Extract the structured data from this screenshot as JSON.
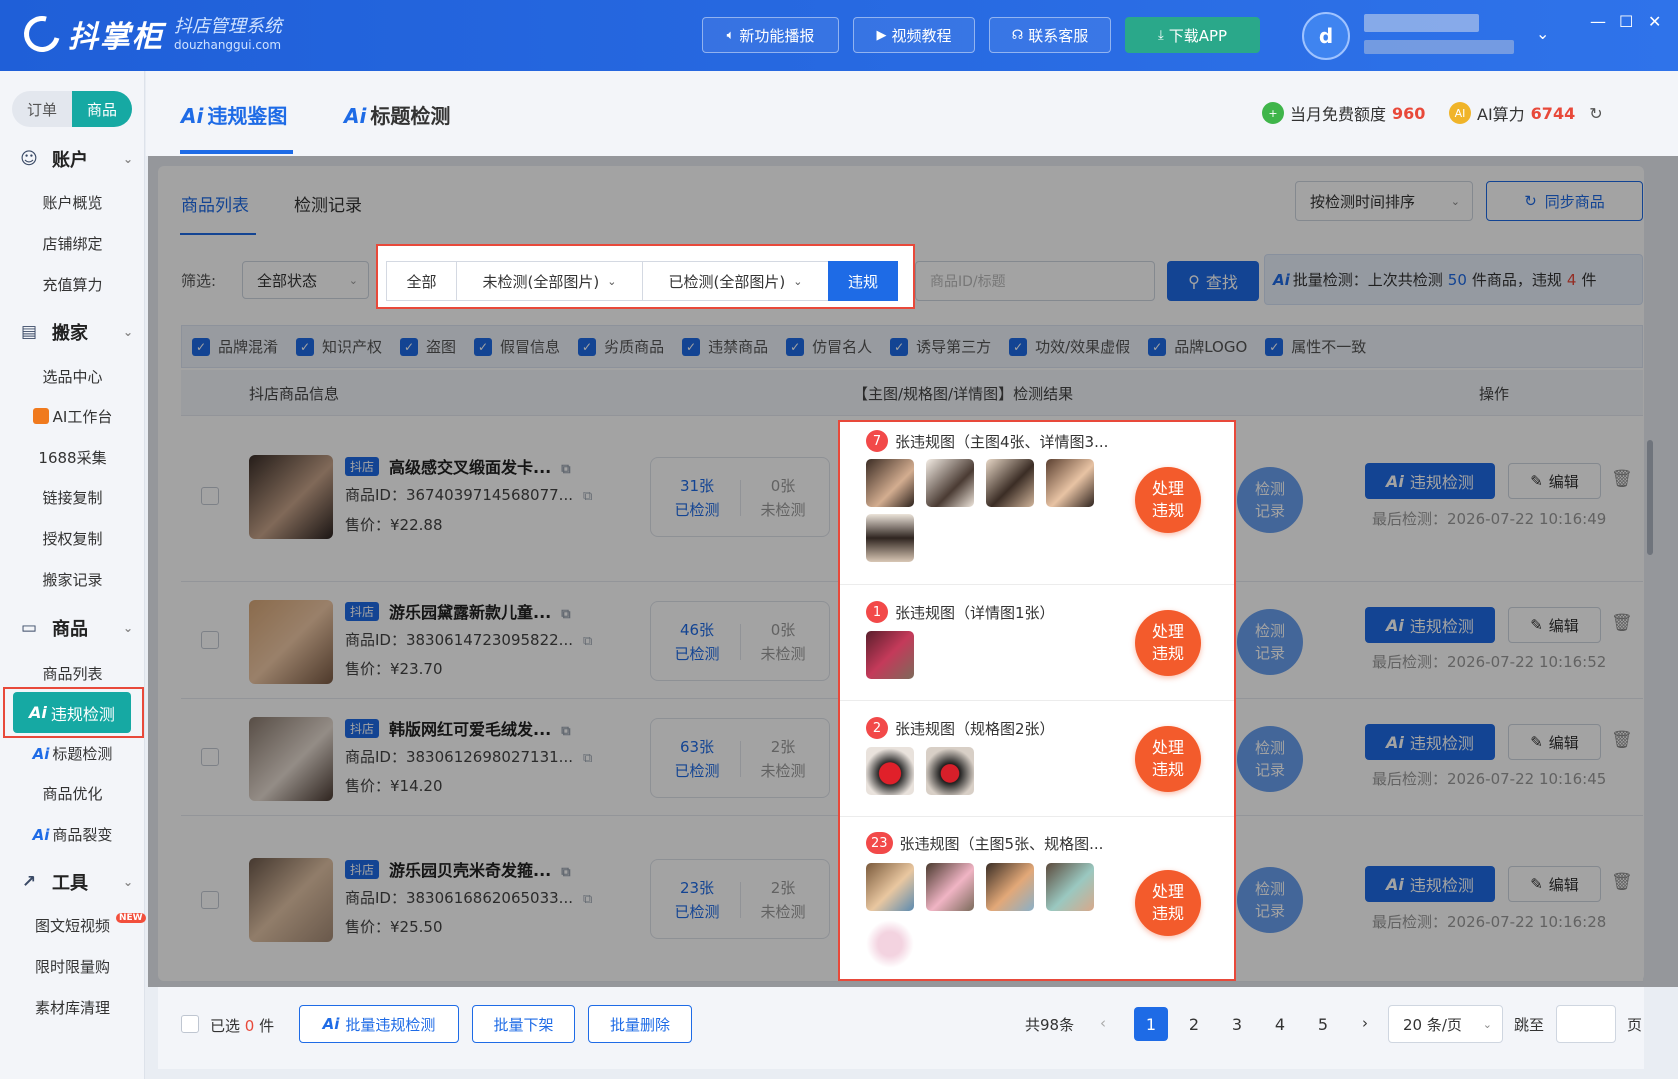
{
  "app": {
    "logo_name": "抖掌柜",
    "logo_subtitle": "抖店管理系统",
    "logo_domain": "douzhanggui.com",
    "avatar_glyph": "d",
    "top_buttons": [
      {
        "icon": "speaker-icon",
        "label": "新功能播报"
      },
      {
        "icon": "video-icon",
        "label": "视频教程"
      },
      {
        "icon": "headset-icon",
        "label": "联系客服"
      },
      {
        "icon": "download-icon",
        "label": "下载APP"
      }
    ]
  },
  "sidebar": {
    "seg_order": "订单",
    "seg_goods": "商品",
    "sections": [
      {
        "title": "账户",
        "icon": "account-icon",
        "items": [
          "账户概览",
          "店铺绑定",
          "充值算力"
        ]
      },
      {
        "title": "搬家",
        "icon": "move-icon",
        "items": [
          "选品中心",
          "AI工作台",
          "1688采集",
          "链接复制",
          "授权复制",
          "搬家记录"
        ]
      },
      {
        "title": "商品",
        "icon": "goods-icon",
        "items": [
          "商品列表",
          "违规检测",
          "标题检测",
          "商品优化",
          "商品裂变"
        ]
      },
      {
        "title": "工具",
        "icon": "chart-icon",
        "items": [
          "图文短视频",
          "限时限量购",
          "素材库清理"
        ]
      }
    ],
    "ai_prefix": "Ai",
    "new_badge": "NEW"
  },
  "header": {
    "tabs": [
      "违规鉴图",
      "标题检测"
    ],
    "ai_prefix": "Ai",
    "quota_label": "当月免费额度",
    "quota_value": "960",
    "power_label": "AI算力",
    "power_value": "6744"
  },
  "panel": {
    "tabs": [
      "商品列表",
      "检测记录"
    ],
    "sort_label": "按检测时间排序",
    "sync_label": "同步商品",
    "filter_label": "筛选:",
    "status_select": "全部状态",
    "seg": [
      "全部",
      "未检测(全部图片)",
      "已检测(全部图片)",
      "违规"
    ],
    "search_placeholder": "商品ID/标题",
    "find_label": "查找",
    "batch_prefix": "批量检测：上次共检测",
    "batch_count": "50",
    "batch_mid": "件商品，违规",
    "batch_violations": "4",
    "batch_suffix": "件",
    "categories": [
      "品牌混淆",
      "知识产权",
      "盗图",
      "假冒信息",
      "劣质商品",
      "违禁商品",
      "仿冒名人",
      "诱导第三方",
      "功效/效果虚假",
      "品牌LOGO",
      "属性不一致"
    ],
    "col_info": "抖店商品信息",
    "col_result": "【主图/规格图/详情图】检测结果",
    "col_ops": "操作"
  },
  "products": [
    {
      "tag": "抖店",
      "title": "高级感交叉缎面发卡...",
      "id": "商品ID：3674039714568077...",
      "price": "售价：¥22.88",
      "checked": "31张",
      "checked_label": "已检测",
      "unchecked": "0张",
      "unchecked_label": "未检测",
      "last": "最后检测：2026-07-22 10:16:49"
    },
    {
      "tag": "抖店",
      "title": "游乐园黛露新款儿童...",
      "id": "商品ID：3830614723095822...",
      "price": "售价：¥23.70",
      "checked": "46张",
      "checked_label": "已检测",
      "unchecked": "0张",
      "unchecked_label": "未检测",
      "last": "最后检测：2026-07-22 10:16:52"
    },
    {
      "tag": "抖店",
      "title": "韩版网红可爱毛绒发...",
      "id": "商品ID：3830612698027131...",
      "price": "售价：¥14.20",
      "checked": "63张",
      "checked_label": "已检测",
      "unchecked": "2张",
      "unchecked_label": "未检测",
      "last": "最后检测：2026-07-22 10:16:45"
    },
    {
      "tag": "抖店",
      "title": "游乐园贝壳米奇发箍...",
      "id": "商品ID：3830616862065033...",
      "price": "售价：¥25.50",
      "checked": "23张",
      "checked_label": "已检测",
      "unchecked": "2张",
      "unchecked_label": "未检测",
      "last": "最后检测：2026-07-22 10:16:28"
    }
  ],
  "row_actions": {
    "record": "检测记录",
    "detect": "违规检测",
    "edit": "编辑"
  },
  "violations": [
    {
      "count": "7",
      "text": "张违规图（主图4张、详情图3..."
    },
    {
      "count": "1",
      "text": "张违规图（详情图1张）"
    },
    {
      "count": "2",
      "text": "张违规图（规格图2张）"
    },
    {
      "count": "23",
      "text": "张违规图（主图5张、规格图..."
    }
  ],
  "fix_label": "处理违规",
  "footer": {
    "selected_prefix": "已选",
    "selected_count": "0",
    "selected_suffix": "件",
    "batch_detect": "批量违规检测",
    "batch_off": "批量下架",
    "batch_delete": "批量删除",
    "total": "共98条",
    "pages": [
      "1",
      "2",
      "3",
      "4",
      "5"
    ],
    "page_size": "20 条/页",
    "jump_label": "跳至",
    "page_unit": "页"
  },
  "colors": {
    "primary": "#1e6be6",
    "teal": "#16a9a3",
    "danger": "#e8493a",
    "fix": "#f35b2c"
  }
}
